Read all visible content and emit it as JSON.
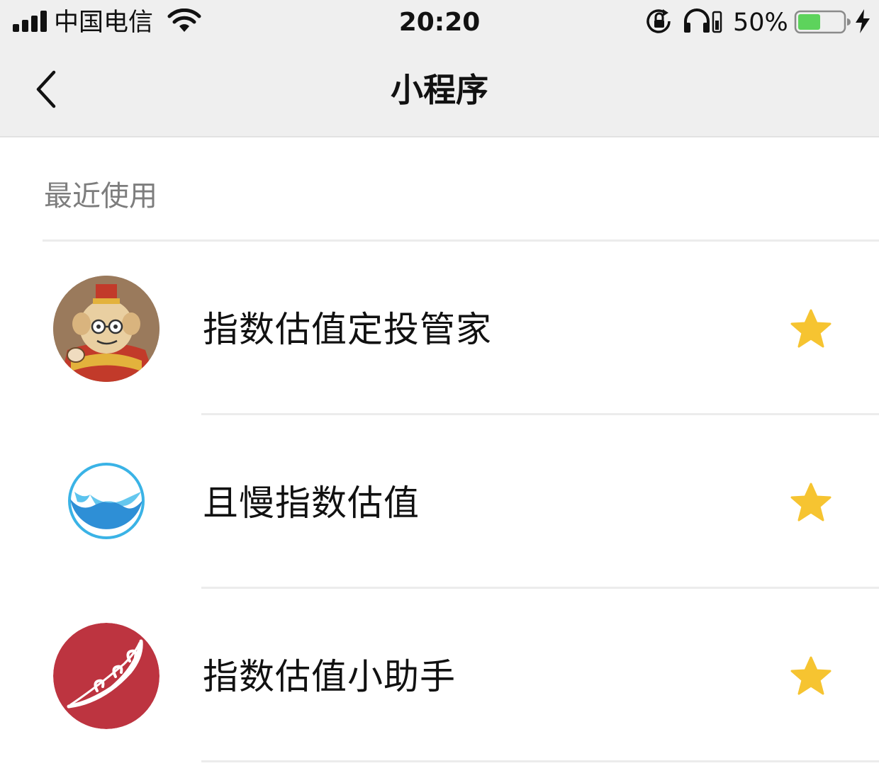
{
  "status_bar": {
    "carrier": "中国电信",
    "time": "20:20",
    "battery_percent": "50%",
    "battery_level": 0.5,
    "icons": [
      "signal-icon",
      "wifi-icon",
      "rotation-lock-icon",
      "headphone-icon",
      "battery-icon",
      "charging-bolt-icon"
    ]
  },
  "nav": {
    "title": "小程序",
    "back_icon": "chevron-left-icon"
  },
  "section": {
    "label": "最近使用"
  },
  "mini_programs": [
    {
      "name": "指数估值定投管家",
      "icon": "monkey-king-avatar",
      "starred": true
    },
    {
      "name": "且慢指数估值",
      "icon": "wave-logo",
      "starred": true
    },
    {
      "name": "指数估值小助手",
      "icon": "pea-pod-logo",
      "starred": true
    }
  ],
  "colors": {
    "header_bg": "#efefef",
    "star": "#f6c431",
    "battery_fill": "#5dd35c",
    "section_label": "#7d7d7d"
  }
}
